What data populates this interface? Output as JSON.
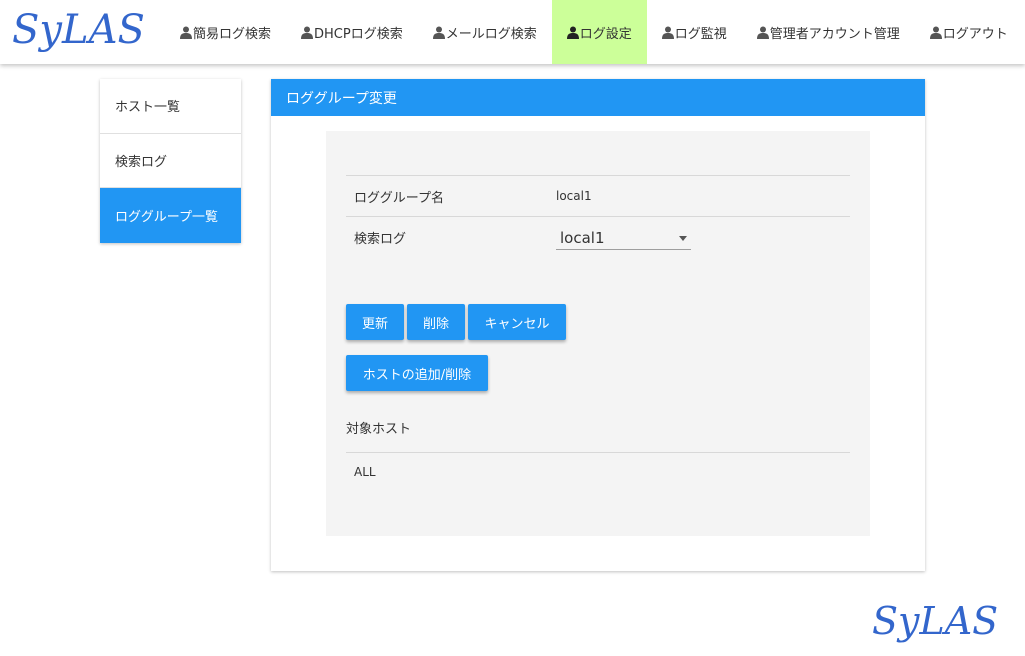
{
  "brand": {
    "logo_text": "SyLAS",
    "color": "#3366cc"
  },
  "nav": {
    "items": [
      {
        "label": "簡易ログ検索",
        "icon": "user-icon",
        "active": false
      },
      {
        "label": "DHCPログ検索",
        "icon": "user-icon",
        "active": false
      },
      {
        "label": "メールログ検索",
        "icon": "user-icon",
        "active": false
      },
      {
        "label": "ログ設定",
        "icon": "user-icon",
        "active": true
      },
      {
        "label": "ログ監視",
        "icon": "user-icon",
        "active": false
      },
      {
        "label": "管理者アカウント管理",
        "icon": "user-icon",
        "active": false
      },
      {
        "label": "ログアウト",
        "icon": "user-icon",
        "active": false
      }
    ],
    "active_color": "#ccff99"
  },
  "sidebar": {
    "items": [
      {
        "label": "ホスト一覧",
        "active": false
      },
      {
        "label": "検索ログ",
        "active": false
      },
      {
        "label": "ロググループ一覧",
        "active": true
      }
    ],
    "active_color": "#2196f3"
  },
  "card": {
    "title": "ロググループ変更",
    "form": {
      "group_name_label": "ロググループ名",
      "group_name_value": "local1",
      "search_log_label": "検索ログ",
      "search_log_selected": "local1"
    },
    "buttons": {
      "update": "更新",
      "delete": "削除",
      "cancel": "キャンセル",
      "add_remove_hosts": "ホストの追加/削除"
    },
    "target_hosts": {
      "label": "対象ホスト",
      "items": [
        "ALL"
      ]
    }
  },
  "footer": {
    "logo_text": "SyLAS"
  },
  "colors": {
    "primary": "#2196f3",
    "panel_bg": "#f4f4f4"
  }
}
